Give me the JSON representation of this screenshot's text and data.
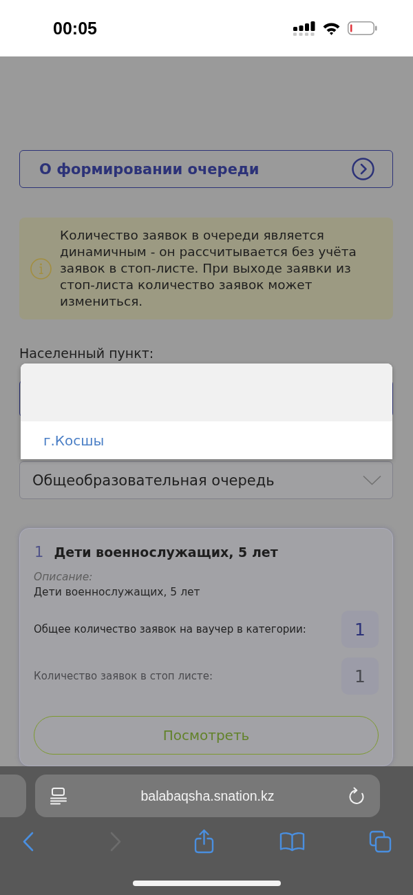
{
  "status_bar": {
    "time": "00:05"
  },
  "queue_info_link": {
    "label": "О формировании очереди"
  },
  "notice": {
    "text": "Количество заявок в очереди является динамичным - он рассчитывается без учёта заявок в стоп-листе. При выходе заявки из стоп-листа количество заявок может измениться."
  },
  "locality": {
    "label": "Населенный пункт:",
    "options": [
      {
        "selected": true
      },
      {
        "label": "г.Косшы",
        "selected": false
      }
    ]
  },
  "queue_type": {
    "value": "Общеобразовательная очередь"
  },
  "categories": [
    {
      "number": "1",
      "title": "Дети военнослужащих, 5 лет",
      "description_label": "Описание:",
      "description": "Дети военнослужащих, 5 лет",
      "stats": [
        {
          "kind": "total",
          "label": "Общее количество заявок на ваучер в категории:",
          "value": "1"
        },
        {
          "kind": "stop_list",
          "label": "Количество заявок в стоп листе:",
          "value": "1"
        }
      ],
      "button": "Посмотреть"
    }
  ],
  "browser": {
    "url": "balabaqsha.snation.kz",
    "back_disabled": false,
    "forward_disabled": true
  }
}
